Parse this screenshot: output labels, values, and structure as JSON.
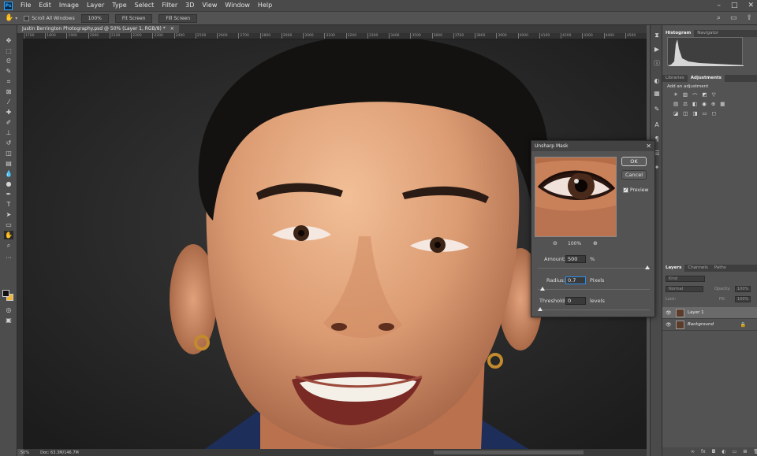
{
  "menubar": {
    "logo": "Ps",
    "items": [
      "File",
      "Edit",
      "Image",
      "Layer",
      "Type",
      "Select",
      "Filter",
      "3D",
      "View",
      "Window",
      "Help"
    ],
    "controls": [
      "–",
      "□",
      "✕"
    ]
  },
  "optionsbar": {
    "scroll_all_label": "Scroll All Windows",
    "zoom_btn": "100%",
    "fit_screen_btn": "Fit Screen",
    "fill_screen_btn": "Fill Screen"
  },
  "document": {
    "tab_title": "Justin Berrington Photography.psd @ 50% (Layer 1, RGB/8) *",
    "tab_close": "×",
    "ruler_ticks": [
      "1700",
      "1800",
      "1900",
      "2000",
      "2100",
      "2200",
      "2300",
      "2400",
      "2500",
      "2600",
      "2700",
      "2800",
      "2900",
      "3000",
      "3100",
      "3200",
      "3300",
      "3400",
      "3500",
      "3600",
      "3700",
      "3800",
      "3900",
      "4000",
      "4100",
      "4200",
      "4300",
      "4400",
      "4500"
    ]
  },
  "status": {
    "zoom": "50%",
    "doc": "Doc: 63.3M/146.7M"
  },
  "panels": {
    "top_tabs": [
      "Histogram",
      "Navigator"
    ],
    "adjust_tabs": [
      "Libraries",
      "Adjustments"
    ],
    "add_adjustment": "Add an adjustment",
    "layers_tabs": [
      "Layers",
      "Channels",
      "Paths"
    ],
    "search_placeholder": "Kind",
    "blend_mode": "Normal",
    "opacity_label": "Opacity:",
    "opacity_value": "100%",
    "lock_label": "Lock:",
    "fill_label": "Fill:",
    "fill_value": "100%",
    "layers": [
      {
        "name": "Layer 1"
      },
      {
        "name": "Background"
      }
    ]
  },
  "dialog": {
    "title": "Unsharp Mask",
    "ok": "OK",
    "cancel": "Cancel",
    "preview_label": "Preview",
    "preview_checked": true,
    "zoom_level": "100%",
    "amount_label": "Amount:",
    "amount_value": "500",
    "amount_unit": "%",
    "amount_fraction": 1.0,
    "radius_label": "Radius:",
    "radius_value": "0.7",
    "radius_unit": "Pixels",
    "radius_fraction": 0.02,
    "threshold_label": "Threshold:",
    "threshold_value": "0",
    "threshold_unit": "levels",
    "threshold_fraction": 0.0
  }
}
